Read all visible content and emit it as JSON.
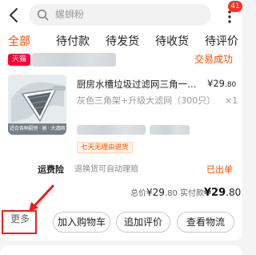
{
  "search": {
    "placeholder": "螺蛳粉"
  },
  "header": {
    "notification_count": "41"
  },
  "tabs": [
    {
      "label": "全部"
    },
    {
      "label": "待付款"
    },
    {
      "label": "待发货"
    },
    {
      "label": "待收货"
    },
    {
      "label": "待评价"
    }
  ],
  "order": {
    "shop_tag": "天猫",
    "status": "交易成功",
    "product": {
      "thumb_caption": "适合各种厨房 · 高 · 大滤网",
      "title": "厨房水槽垃圾过滤网三角一次性…",
      "price_main": "¥29",
      "price_decimal": ".80",
      "spec": "灰色三角架+升级大滤网（300只）",
      "qty": "×1",
      "return_tag": "七天无理由退货"
    },
    "insurance": {
      "label": "运费险",
      "desc": "退换货可自动理赔",
      "status": "已出单"
    },
    "totals": {
      "total_label": "总价",
      "total_main": "¥29",
      "total_decimal": ".80",
      "paid_label": "实付款",
      "paid_main": "¥29",
      "paid_decimal": ".80"
    },
    "actions": {
      "more": "更多",
      "add_cart": "加入购物车",
      "add_review": "追加评价",
      "logistics": "查看物流"
    }
  },
  "colors": {
    "accent": "#ff5000",
    "tmall": "#ff0036",
    "highlight_box": "#f01b1b"
  }
}
